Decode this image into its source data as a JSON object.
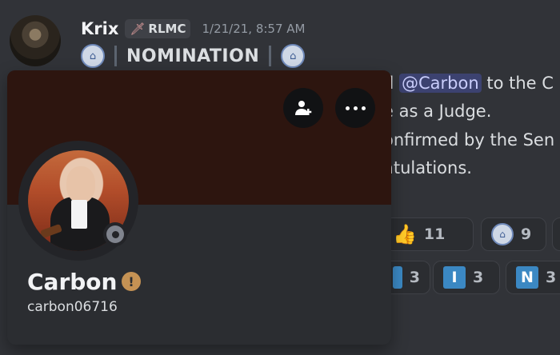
{
  "message": {
    "author": "Krix",
    "role_tag": "RLMC",
    "timestamp": "1/21/21, 8:57 AM",
    "title": "NOMINATION",
    "lines": {
      "l1_prefix": "d ",
      "l1_mention": "@Carbon",
      "l1_suffix": " to the C",
      "l2": "e as a Judge.",
      "l3": "onfirmed by the Sen",
      "l4": "atulations."
    }
  },
  "reactions": {
    "row1": [
      {
        "emoji": "thumbs-up",
        "glyph": "👍",
        "count": "11"
      },
      {
        "emoji": "server-emblem",
        "count": "9"
      }
    ],
    "row2": [
      {
        "emoji": "regional-indicator",
        "count": "3"
      },
      {
        "emoji": "letter-i",
        "letter": "I",
        "count": "3"
      },
      {
        "emoji": "letter-n",
        "letter": "N",
        "count": "3"
      }
    ]
  },
  "profile": {
    "display_name": "Carbon",
    "username": "carbon06716",
    "status": "offline",
    "badge_glyph": "!",
    "banner_color": "#2d150f",
    "accent_color": "#c59254"
  }
}
